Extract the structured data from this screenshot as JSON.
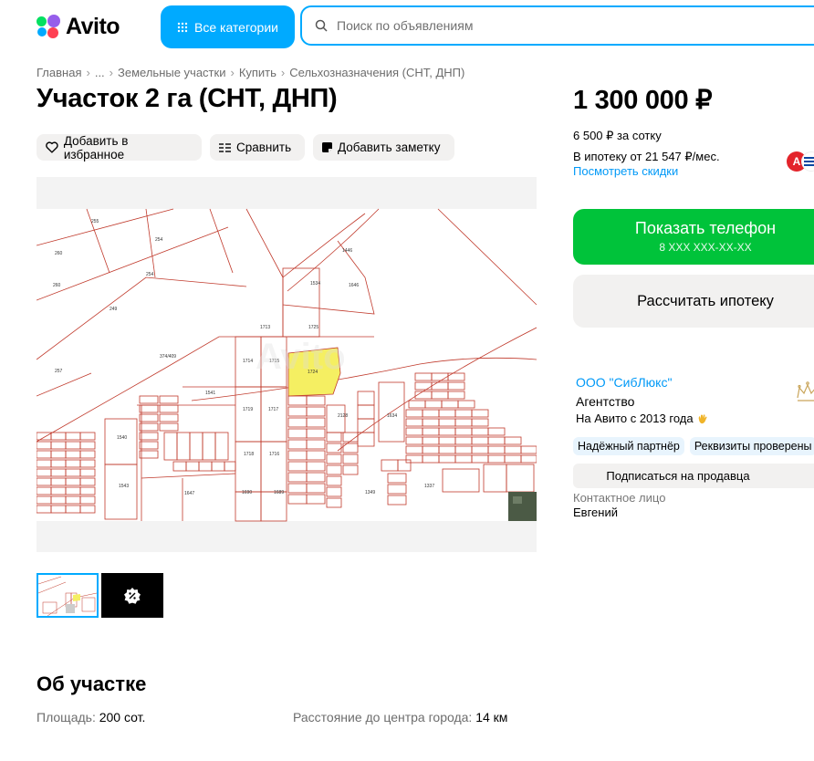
{
  "header": {
    "logo_text": "Avito",
    "categories_button": "Все категории",
    "search_placeholder": "Поиск по объявлениям"
  },
  "breadcrumb": [
    "Главная",
    "...",
    "Земельные участки",
    "Купить",
    "Сельхозназначения (СНТ, ДНП)"
  ],
  "title": "Участок 2 га (СНТ, ДНП)",
  "actions": {
    "favorite": "Добавить в избранное",
    "compare": "Сравнить",
    "note": "Добавить заметку"
  },
  "price": {
    "value": "1 300 000 ₽",
    "per_unit": "6 500 ₽ за сотку",
    "mortgage": "В ипотеку от 21 547 ₽/мес.",
    "discounts_link": "Посмотреть скидки"
  },
  "buttons": {
    "show_phone": "Показать телефон",
    "phone_mask": "8 XXX XXX-XX-XX",
    "calc_mortgage": "Рассчитать ипотеку",
    "subscribe": "Подписаться на продавца"
  },
  "seller": {
    "name": "ООО \"СибЛюкс\"",
    "type": "Агентство",
    "since": "На Авито с 2013 года",
    "badges": [
      "Надёжный партнёр",
      "Реквизиты проверены"
    ],
    "contact_label": "Контактное лицо",
    "contact_name": "Евгений"
  },
  "about": {
    "title": "Об участке",
    "area_label": "Площадь:",
    "area_value": "200 сот.",
    "distance_label": "Расстояние до центра города:",
    "distance_value": "14 км"
  },
  "colors": {
    "accent_blue": "#00aaff",
    "link_blue": "#0099f7",
    "green": "#00c33a",
    "plot_line": "#c0392b",
    "plot_highlight": "#f5ef62"
  }
}
